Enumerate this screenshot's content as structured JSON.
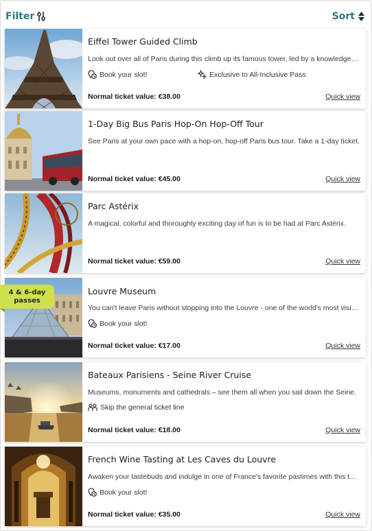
{
  "toolbar": {
    "filter_label": "Filter",
    "sort_label": "Sort"
  },
  "colors": {
    "accent": "#2a7a83",
    "badge": "#cfe04a"
  },
  "cards": [
    {
      "title": "Eiffel Tower Guided Climb",
      "description": "Look out over all of Paris during this climb up its famous tower, led by a knowledgeable guide.",
      "features": [
        {
          "icon": "clock-pin-icon",
          "text": "Book your slot!"
        },
        {
          "icon": "sparkle-icon",
          "text": "Exclusive to All-Inclusive Pass"
        }
      ],
      "price": "Normal ticket value: €38.00",
      "quick_view": "Quick view"
    },
    {
      "title": "1-Day Big Bus Paris Hop-On Hop-Off Tour",
      "description": "See Paris at your own pace with a hop-on, hop-off Paris bus tour. Take a 1-day ticket.",
      "features": [],
      "price": "Normal ticket value: €45.00",
      "quick_view": "Quick view"
    },
    {
      "title": "Parc Astérix",
      "description": "A magical, colorful and thoroughly exciting day of fun is to be had at Parc Astérix.",
      "features": [],
      "price": "Normal ticket value: €59.00",
      "quick_view": "Quick view"
    },
    {
      "title": "Louvre Museum",
      "badge_line1": "4 & 6-day",
      "badge_line2": "passes",
      "description": "You can't leave Paris without stopping into the Louvre - one of the world's most visited museums.",
      "features": [
        {
          "icon": "clock-pin-icon",
          "text": "Book your slot!"
        }
      ],
      "price": "Normal ticket value: €17.00",
      "quick_view": "Quick view"
    },
    {
      "title": "Bateaux Parisiens - Seine River Cruise",
      "description": "Museums, monuments and cathedrals – see them all when you sail down the Seine.",
      "features": [
        {
          "icon": "people-icon",
          "text": "Skip the general ticket line"
        }
      ],
      "price": "Normal ticket value: €18.00",
      "quick_view": "Quick view"
    },
    {
      "title": "French Wine Tasting at Les Caves du Louvre",
      "description": "Awaken your tastebuds and indulge in one of France's favorite pastimes with this tasting.",
      "features": [
        {
          "icon": "clock-pin-icon",
          "text": "Book your slot!"
        }
      ],
      "price": "Normal ticket value: €35.00",
      "quick_view": "Quick view"
    }
  ]
}
